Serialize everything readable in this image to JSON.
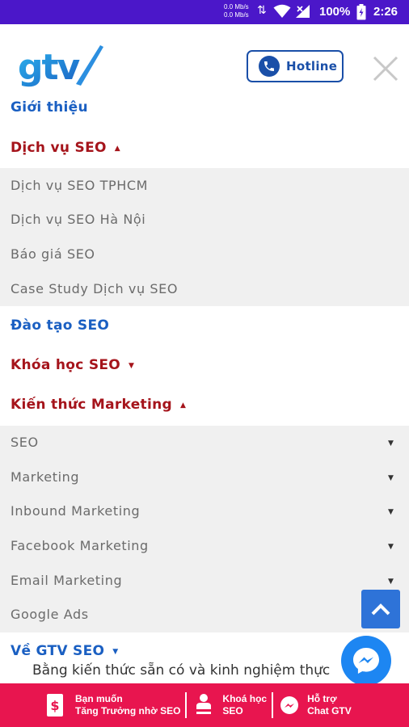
{
  "status_bar": {
    "net_up": "0.0 Mb/s",
    "net_down": "0.0 Mb/s",
    "battery": "100%",
    "time": "2:26",
    "icons": [
      "data-arrows-icon",
      "wifi-icon",
      "signal-icon",
      "battery-icon"
    ]
  },
  "header": {
    "logo_text": "gtv",
    "hotline_label": "Hotline",
    "hotline_icon": "phone-icon",
    "close_icon": "close-icon"
  },
  "colors": {
    "status_bar": "#4b17c9",
    "brand_blue": "#1a5fc2",
    "brand_red": "#a5141b",
    "bottom_bar": "#e8154f",
    "messenger": "#1d86f2"
  },
  "menu": {
    "gioi_thieu": "Giới thiệu",
    "dich_vu_seo": {
      "label": "Dịch vụ SEO",
      "caret": "▲",
      "items": [
        "Dịch vụ SEO TPHCM",
        "Dịch vụ SEO Hà Nội",
        "Báo giá SEO",
        "Case Study Dịch vụ SEO"
      ]
    },
    "dao_tao_seo": "Đào tạo SEO",
    "khoa_hoc_seo": {
      "label": "Khóa học SEO",
      "caret": "▼"
    },
    "kien_thuc_marketing": {
      "label": "Kiến thức Marketing",
      "caret": "▲",
      "items": [
        "SEO",
        "Marketing",
        "Inbound Marketing",
        "Facebook Marketing",
        "Email Marketing",
        "Google Ads"
      ],
      "item_caret": "▼"
    },
    "ve_gtv_seo": {
      "label": "Về GTV SEO",
      "caret": "▼"
    }
  },
  "background_text": "Bằng kiến thức sẵn có và kinh nghiệm thực",
  "floating": {
    "scroll_top_icon": "chevron-up-icon",
    "messenger_icon": "messenger-icon"
  },
  "bottom_bar": {
    "item1": {
      "line1": "Bạn muốn",
      "line2": "Tăng Trưởng nhờ SEO",
      "icon": "dollar-tag-icon"
    },
    "item2": {
      "line1": "Khoá học",
      "line2": "SEO",
      "icon": "people-icon"
    },
    "item3": {
      "line1": "Hỗ trợ",
      "line2": "Chat GTV",
      "icon": "chat-icon"
    }
  }
}
